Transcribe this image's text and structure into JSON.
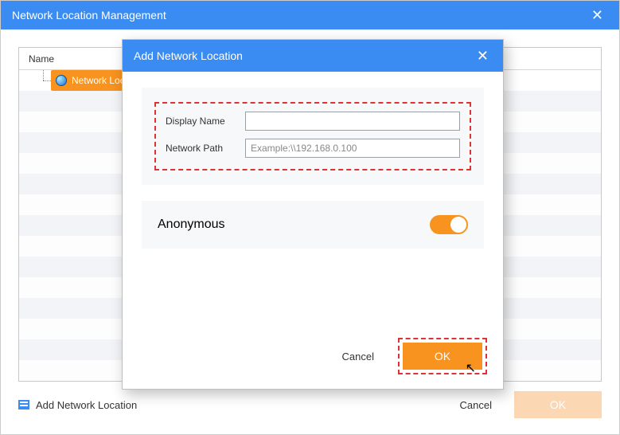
{
  "window": {
    "title": "Network Location Management",
    "close_glyph": "✕"
  },
  "panel": {
    "column_name": "Name",
    "selected_item": "Network Location"
  },
  "footer": {
    "add_link_label": "Add Network Location",
    "cancel_label": "Cancel",
    "ok_label": "OK"
  },
  "modal": {
    "title": "Add Network Location",
    "close_glyph": "✕",
    "fields": {
      "display_name_label": "Display Name",
      "display_name_value": "",
      "network_path_label": "Network Path",
      "network_path_placeholder": "Example:\\\\192.168.0.100"
    },
    "anonymous_label": "Anonymous",
    "anonymous_on": true,
    "cancel_label": "Cancel",
    "ok_label": "OK"
  }
}
